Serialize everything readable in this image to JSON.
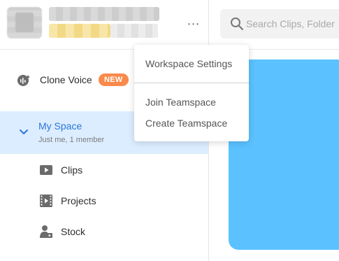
{
  "sidebar": {
    "clone_voice": {
      "label": "Clone Voice",
      "badge": "NEW"
    },
    "my_space": {
      "title": "My Space",
      "subtitle": "Just me, 1 member"
    },
    "items": [
      {
        "label": "Clips",
        "icon": "clips-icon"
      },
      {
        "label": "Projects",
        "icon": "projects-icon"
      },
      {
        "label": "Stock",
        "icon": "stock-icon"
      }
    ]
  },
  "header": {
    "more_icon": "⋯"
  },
  "search": {
    "placeholder": "Search Clips, Folder"
  },
  "dropdown": {
    "items": [
      "Workspace Settings",
      "Join Teamspace",
      "Create Teamspace"
    ]
  },
  "colors": {
    "accent": "#2b77d9",
    "selected_bg": "#dcedff",
    "badge": "#f98a4c",
    "preview": "#5bc2ff"
  }
}
